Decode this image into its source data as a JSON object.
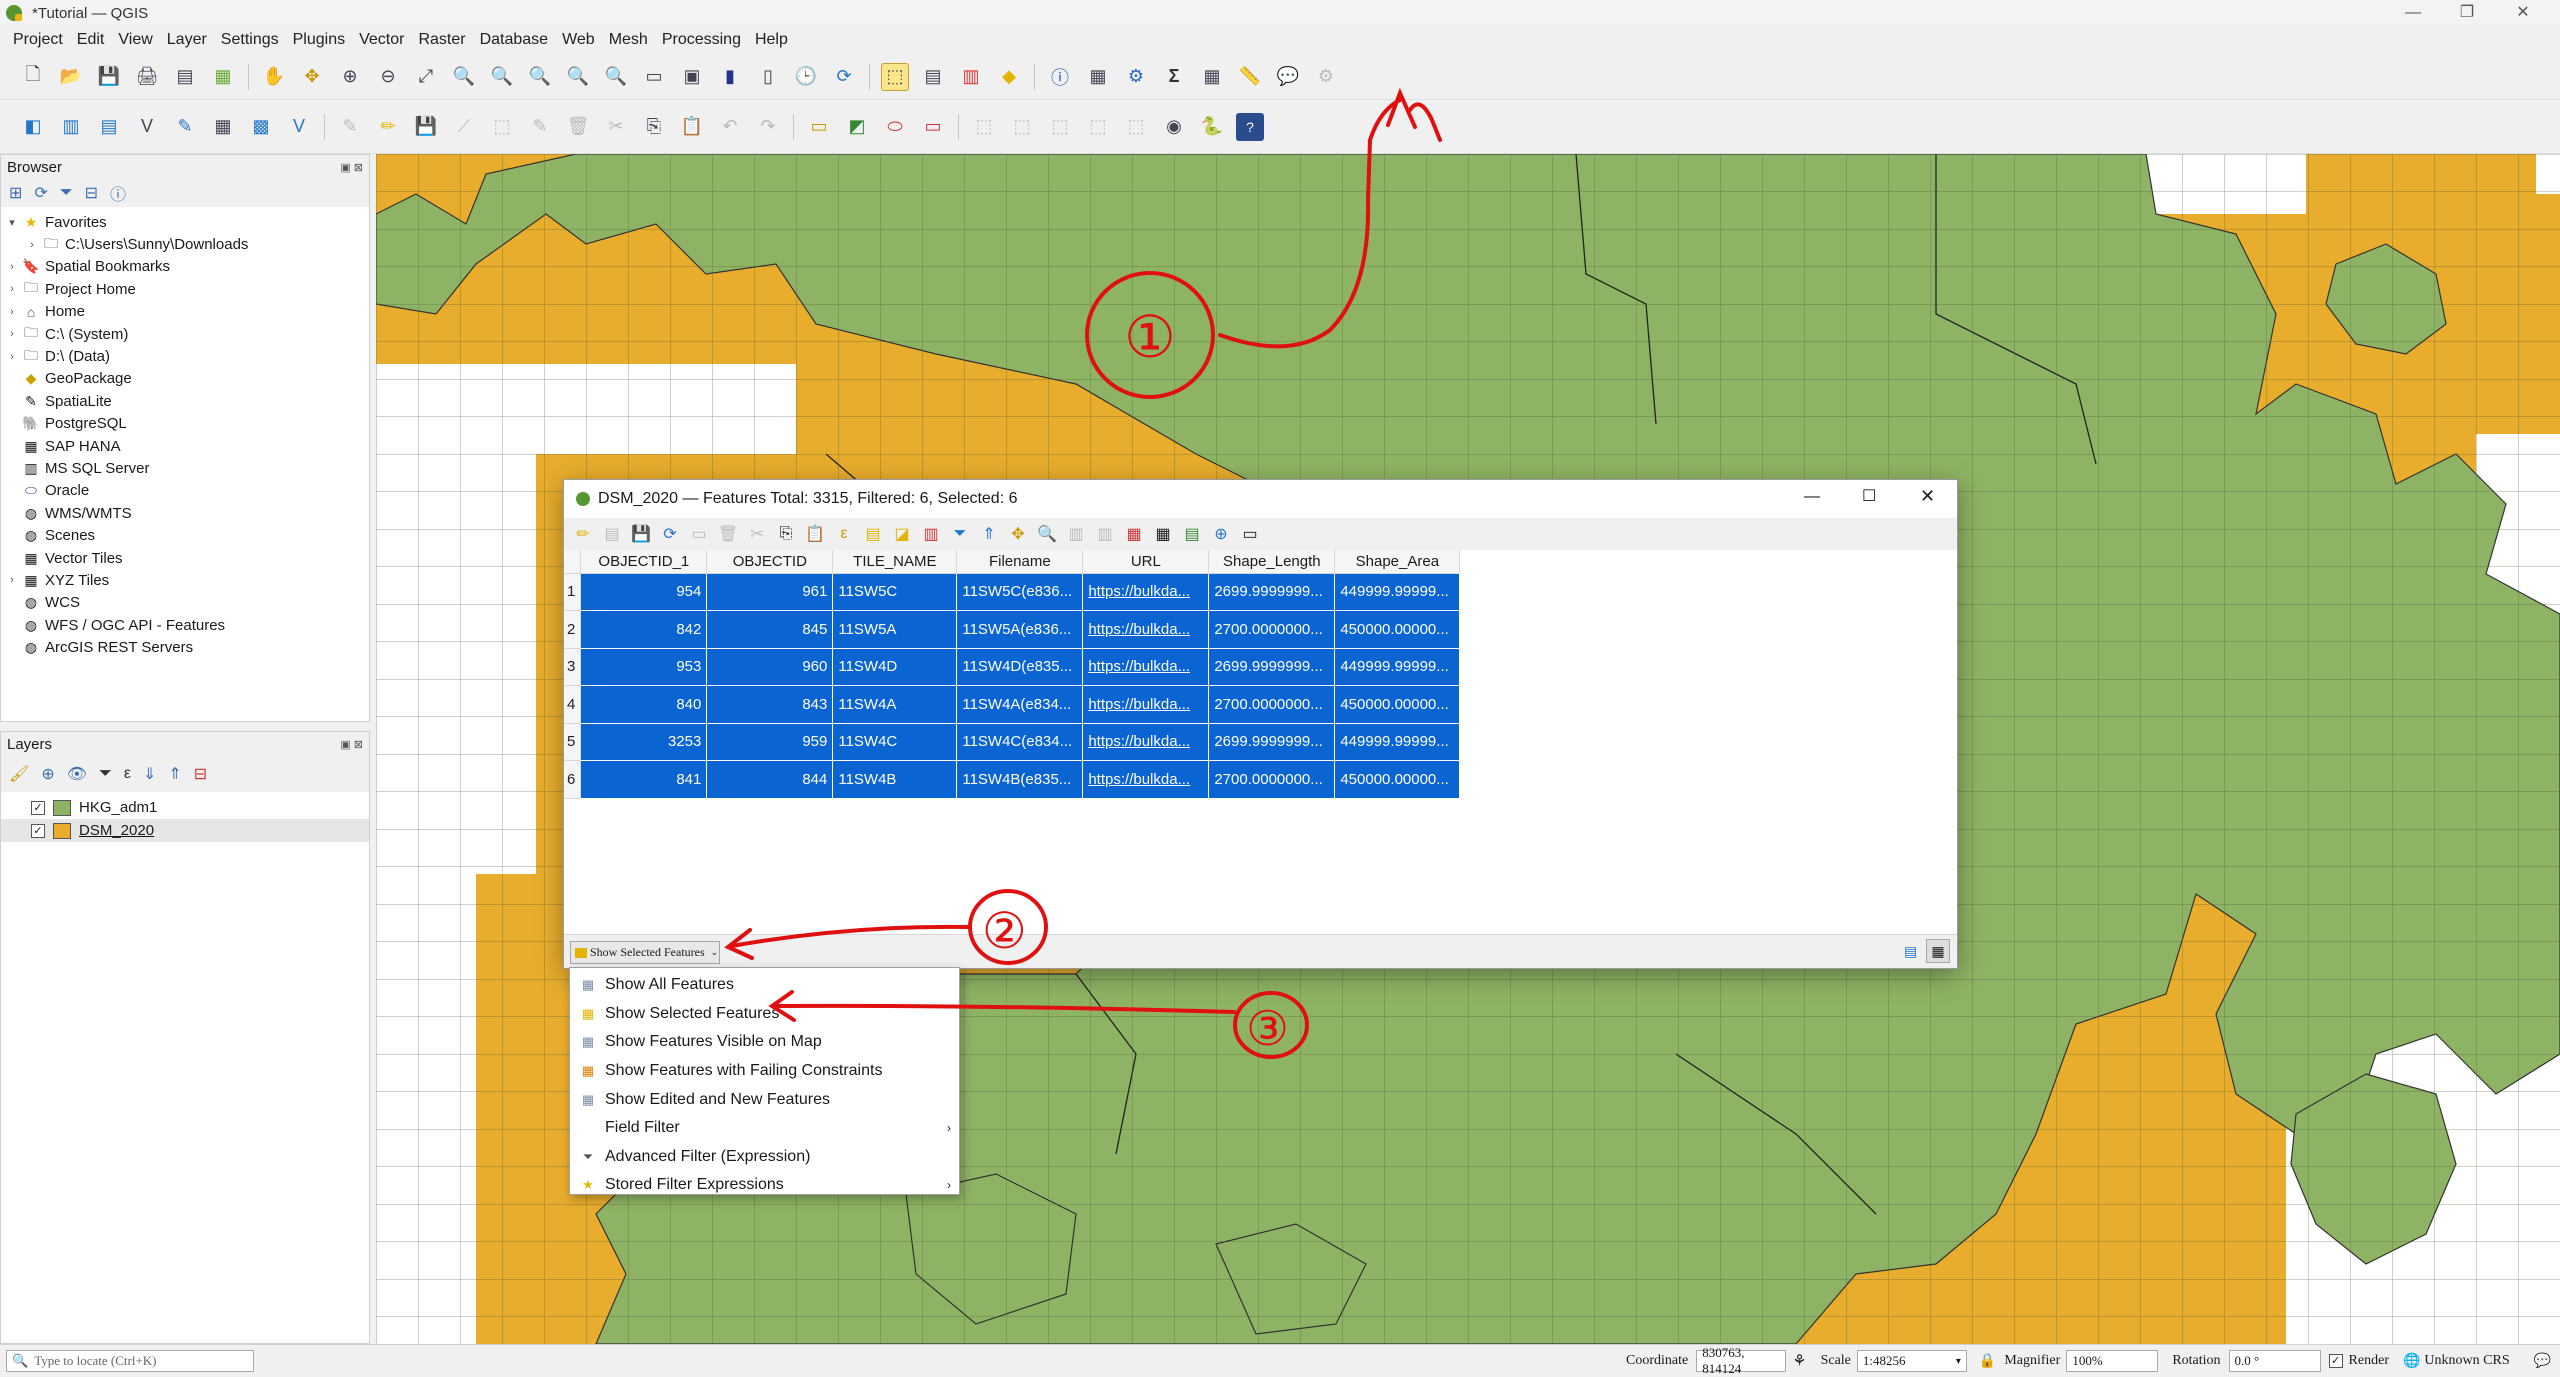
{
  "window": {
    "title": "*Tutorial — QGIS",
    "controls": [
      "—",
      "❐",
      "✕"
    ]
  },
  "menu": [
    "Project",
    "Edit",
    "View",
    "Layer",
    "Settings",
    "Plugins",
    "Vector",
    "Raster",
    "Database",
    "Web",
    "Mesh",
    "Processing",
    "Help"
  ],
  "browser": {
    "title": "Browser",
    "items": [
      {
        "label": "Favorites",
        "icon": "star-icon",
        "expand": "▾",
        "indent": 0
      },
      {
        "label": "C:\\Users\\Sunny\\Downloads",
        "icon": "folder-icon",
        "expand": "›",
        "indent": 1
      },
      {
        "label": "Spatial Bookmarks",
        "icon": "bookmark-icon",
        "expand": "›",
        "indent": 0
      },
      {
        "label": "Project Home",
        "icon": "project-home-icon",
        "expand": "›",
        "indent": 0
      },
      {
        "label": "Home",
        "icon": "home-icon",
        "expand": "›",
        "indent": 0
      },
      {
        "label": "C:\\ (System)",
        "icon": "drive-icon",
        "expand": "›",
        "indent": 0
      },
      {
        "label": "D:\\ (Data)",
        "icon": "drive-icon",
        "expand": "›",
        "indent": 0
      },
      {
        "label": "GeoPackage",
        "icon": "geopackage-icon",
        "expand": "",
        "indent": 0
      },
      {
        "label": "SpatiaLite",
        "icon": "spatialite-icon",
        "expand": "",
        "indent": 0
      },
      {
        "label": "PostgreSQL",
        "icon": "postgresql-icon",
        "expand": "",
        "indent": 0
      },
      {
        "label": "SAP HANA",
        "icon": "sap-hana-icon",
        "expand": "",
        "indent": 0
      },
      {
        "label": "MS SQL Server",
        "icon": "mssql-icon",
        "expand": "",
        "indent": 0
      },
      {
        "label": "Oracle",
        "icon": "oracle-icon",
        "expand": "",
        "indent": 0
      },
      {
        "label": "WMS/WMTS",
        "icon": "wms-icon",
        "expand": "",
        "indent": 0
      },
      {
        "label": "Scenes",
        "icon": "scenes-icon",
        "expand": "",
        "indent": 0
      },
      {
        "label": "Vector Tiles",
        "icon": "vector-tiles-icon",
        "expand": "",
        "indent": 0
      },
      {
        "label": "XYZ Tiles",
        "icon": "xyz-tiles-icon",
        "expand": "›",
        "indent": 0
      },
      {
        "label": "WCS",
        "icon": "wcs-icon",
        "expand": "",
        "indent": 0
      },
      {
        "label": "WFS / OGC API - Features",
        "icon": "wfs-icon",
        "expand": "",
        "indent": 0
      },
      {
        "label": "ArcGIS REST Servers",
        "icon": "arcgis-icon",
        "expand": "",
        "indent": 0
      }
    ]
  },
  "layers": {
    "title": "Layers",
    "items": [
      {
        "label": "HKG_adm1",
        "color": "#8fb364",
        "checked": "✓"
      },
      {
        "label": "DSM_2020",
        "color": "#e8ad2c",
        "checked": "✓"
      }
    ]
  },
  "dialog": {
    "title": "DSM_2020 — Features Total: 3315, Filtered: 6, Selected: 6",
    "columns": [
      "OBJECTID_1",
      "OBJECTID",
      "TILE_NAME",
      "Filename",
      "URL",
      "Shape_Length",
      "Shape_Area"
    ],
    "rows": [
      {
        "n": "1",
        "OBJECTID_1": "954",
        "OBJECTID": "961",
        "TILE_NAME": "11SW5C",
        "Filename": "11SW5C(e836...",
        "URL": "https://bulkda...",
        "Shape_Length": "2699.9999999...",
        "Shape_Area": "449999.99999..."
      },
      {
        "n": "2",
        "OBJECTID_1": "842",
        "OBJECTID": "845",
        "TILE_NAME": "11SW5A",
        "Filename": "11SW5A(e836...",
        "URL": "https://bulkda...",
        "Shape_Length": "2700.0000000...",
        "Shape_Area": "450000.00000..."
      },
      {
        "n": "3",
        "OBJECTID_1": "953",
        "OBJECTID": "960",
        "TILE_NAME": "11SW4D",
        "Filename": "11SW4D(e835...",
        "URL": "https://bulkda...",
        "Shape_Length": "2699.9999999...",
        "Shape_Area": "449999.99999..."
      },
      {
        "n": "4",
        "OBJECTID_1": "840",
        "OBJECTID": "843",
        "TILE_NAME": "11SW4A",
        "Filename": "11SW4A(e834...",
        "URL": "https://bulkda...",
        "Shape_Length": "2700.0000000...",
        "Shape_Area": "450000.00000..."
      },
      {
        "n": "5",
        "OBJECTID_1": "3253",
        "OBJECTID": "959",
        "TILE_NAME": "11SW4C",
        "Filename": "11SW4C(e834...",
        "URL": "https://bulkda...",
        "Shape_Length": "2699.9999999...",
        "Shape_Area": "449999.99999..."
      },
      {
        "n": "6",
        "OBJECTID_1": "841",
        "OBJECTID": "844",
        "TILE_NAME": "11SW4B",
        "Filename": "11SW4B(e835...",
        "URL": "https://bulkda...",
        "Shape_Length": "2700.0000000...",
        "Shape_Area": "450000.00000..."
      }
    ],
    "filter_button": "Show Selected Features",
    "selection_color": "#0a64d2"
  },
  "popup_menu": [
    {
      "label": "Show All Features",
      "icon": "table-icon",
      "submenu": ""
    },
    {
      "label": "Show Selected Features",
      "icon": "selected-table-icon",
      "submenu": ""
    },
    {
      "label": "Show Features Visible on Map",
      "icon": "map-table-icon",
      "submenu": ""
    },
    {
      "label": "Show Features with Failing Constraints",
      "icon": "constraint-icon",
      "submenu": ""
    },
    {
      "label": "Show Edited and New Features",
      "icon": "edit-table-icon",
      "submenu": ""
    },
    {
      "label": "Field Filter",
      "icon": "",
      "submenu": "›"
    },
    {
      "label": "Advanced Filter (Expression)",
      "icon": "filter-icon",
      "submenu": ""
    },
    {
      "label": "Stored Filter Expressions",
      "icon": "star-icon",
      "submenu": "›"
    }
  ],
  "annotations": [
    "①",
    "②",
    "③"
  ],
  "statusbar": {
    "locate_placeholder": "Type to locate (Ctrl+K)",
    "coordinate_label": "Coordinate",
    "coordinate_value": "830763, 814124",
    "scale_label": "Scale",
    "scale_value": "1:48256",
    "magnifier_label": "Magnifier",
    "magnifier_value": "100%",
    "rotation_label": "Rotation",
    "rotation_value": "0.0 °",
    "render_label": "Render",
    "crs_label": "Unknown CRS"
  },
  "colors": {
    "land": "#8fb364",
    "tiles": "#e8ad2c",
    "grid": "#4a5a3a",
    "annotation": "#e01010"
  }
}
